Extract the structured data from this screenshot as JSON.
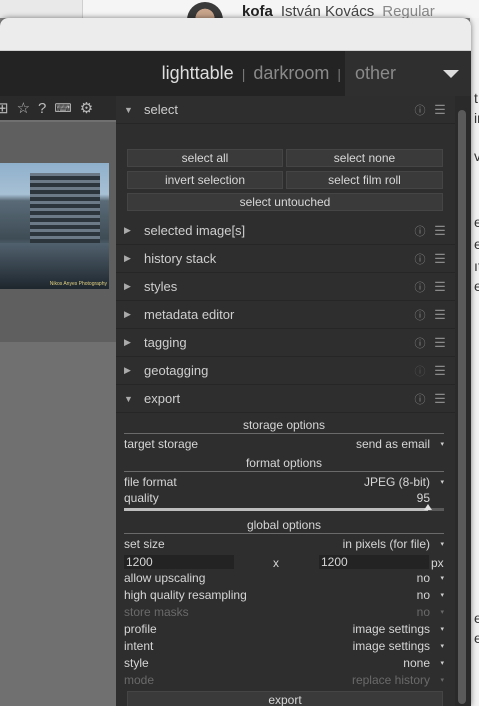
{
  "background": {
    "user_handle": "kofa",
    "user_name": "István Kovács",
    "user_tag": "Regular",
    "side_letters": [
      "t",
      "ir",
      "v",
      "e,",
      "e",
      "ıt",
      "e",
      "e.",
      "e"
    ]
  },
  "header": {
    "views": [
      "lighttable",
      "darkroom",
      "other"
    ],
    "separator": "|"
  },
  "left_toolbar": {
    "icons": [
      "grid-icon",
      "star-icon",
      "help-icon",
      "keyboard-icon",
      "gear-icon"
    ]
  },
  "thumbnail": {
    "watermark": "Nikos Anyes Photography"
  },
  "modules": {
    "select": {
      "title": "select",
      "buttons": [
        "select all",
        "select none",
        "invert selection",
        "select film roll",
        "select untouched"
      ]
    },
    "collapsed": [
      "selected image[s]",
      "history stack",
      "styles",
      "metadata editor",
      "tagging",
      "geotagging"
    ],
    "export": {
      "title": "export",
      "storage_options": "storage options",
      "target_storage_label": "target storage",
      "target_storage_value": "send as email",
      "format_options": "format options",
      "file_format_label": "file format",
      "file_format_value": "JPEG (8-bit)",
      "quality_label": "quality",
      "quality_value": "95",
      "quality_fraction": 0.95,
      "global_options": "global options",
      "set_size_label": "set size",
      "set_size_value": "in pixels (for file)",
      "width": "1200",
      "x": "x",
      "height": "1200",
      "unit": "px",
      "allow_upscaling_label": "allow upscaling",
      "allow_upscaling_value": "no",
      "hq_label": "high quality resampling",
      "hq_value": "no",
      "store_masks_label": "store masks",
      "store_masks_value": "no",
      "profile_label": "profile",
      "profile_value": "image settings",
      "intent_label": "intent",
      "intent_value": "image settings",
      "style_label": "style",
      "style_value": "none",
      "mode_label": "mode",
      "mode_value": "replace history",
      "export_button": "export"
    }
  },
  "icons": {
    "expanded": "▼",
    "collapsed": "▶",
    "reset": "ⓘ",
    "presets": "☰",
    "dropdown": "▾"
  },
  "colors": {
    "panel_bg": "#2e2e2e",
    "text": "#d6d6d6",
    "dim_text": "#6a6a6a"
  }
}
